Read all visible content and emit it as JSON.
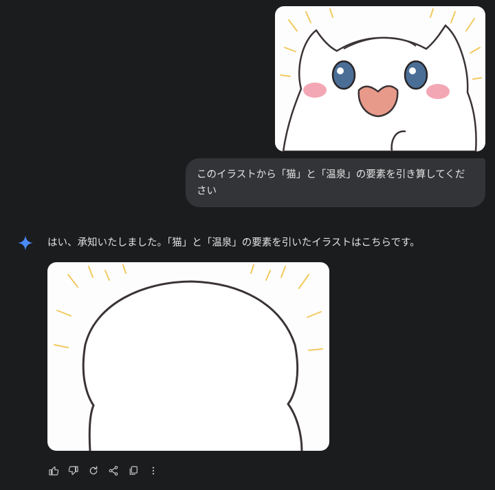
{
  "conversation": {
    "user_message": {
      "image_icon": "white-cat-illustration",
      "text": "このイラストから「猫」と「温泉」の要素を引き算してください"
    },
    "assistant_message": {
      "avatar_icon": "gemini-sparkle-icon",
      "text": "はい、承知いたしました。「猫」と「温泉」の要素を引いたイラストはこちらです。",
      "image_icon": "blank-round-shape-illustration"
    },
    "actions": [
      {
        "icon": "thumbs-up-icon"
      },
      {
        "icon": "thumbs-down-icon"
      },
      {
        "icon": "regenerate-icon"
      },
      {
        "icon": "share-icon"
      },
      {
        "icon": "copy-icon"
      },
      {
        "icon": "more-vert-icon"
      }
    ]
  },
  "colors": {
    "background": "#1b1c1e",
    "bubble": "#333437",
    "text": "#e3e3e3",
    "icon": "#c4c7c5",
    "sparkle": "#4a8af4",
    "ray_gold": "#f0c040"
  }
}
